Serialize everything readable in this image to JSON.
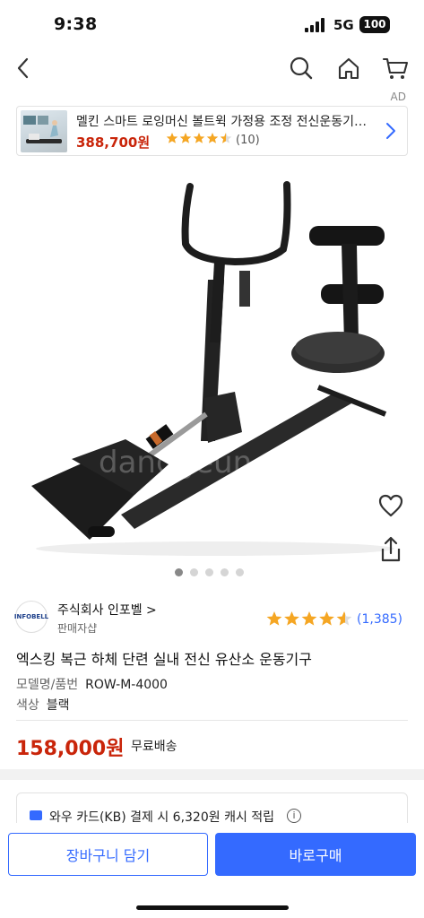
{
  "status": {
    "time": "9:38",
    "network": "5G",
    "battery": "100"
  },
  "nav": {
    "icons": [
      "back-icon",
      "search-icon",
      "home-icon",
      "cart-icon"
    ]
  },
  "ad": {
    "label": "AD",
    "title": "멜킨 스마트 로잉머신 볼트윅 가정용 조정 전신운동기…",
    "price": "388,700원",
    "rating": 4.5,
    "review_count": "(10)"
  },
  "gallery": {
    "total_images": 5,
    "current_index": 1
  },
  "seller": {
    "logo_text": "INFOBELL",
    "name": "주식회사 인포벨 >",
    "subtitle": "판매자샵",
    "rating": 4.5,
    "review_count": "(1,385)"
  },
  "product": {
    "title": "엑스킹 복근 하체 단련 실내 전신 유산소 운동기구",
    "specs": [
      {
        "key": "모델명/품번",
        "value": "ROW-M-4000"
      },
      {
        "key": "색상",
        "value": "블랙"
      }
    ],
    "price": "158,000원",
    "shipping": "무료배송"
  },
  "promo": {
    "text": "와우 카드(KB) 결제 시 6,320원 캐시 적립",
    "info": "i"
  },
  "actions": {
    "cart_label": "장바구니 담기",
    "buy_label": "바로구매"
  },
  "colors": {
    "accent": "#346aff",
    "price": "#c9250a",
    "star": "#f5a623"
  }
}
